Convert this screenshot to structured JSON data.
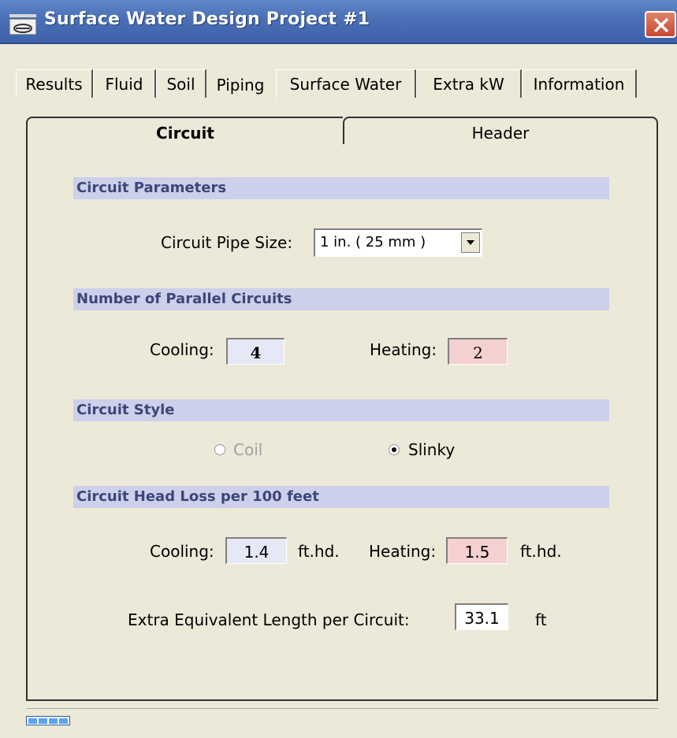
{
  "window": {
    "title": "Surface Water Design Project #1"
  },
  "tabs": [
    "Results",
    "Fluid",
    "Soil",
    "Piping",
    "Surface Water",
    "Extra kW",
    "Information"
  ],
  "active_tab": "Piping",
  "subtabs": {
    "circuit": "Circuit",
    "header": "Header"
  },
  "sections": {
    "params": "Circuit Parameters",
    "parallel": "Number of Parallel Circuits",
    "style": "Circuit Style",
    "headloss": "Circuit Head Loss per 100 feet"
  },
  "pipe_size": {
    "label": "Circuit Pipe Size:",
    "value": "1 in. ( 25 mm )"
  },
  "parallel": {
    "cooling_label": "Cooling:",
    "cooling": "4",
    "heating_label": "Heating:",
    "heating": "2"
  },
  "style": {
    "coil": "Coil",
    "slinky": "Slinky",
    "selected": "Slinky"
  },
  "headloss": {
    "cooling_label": "Cooling:",
    "cooling": "1.4",
    "cooling_unit": "ft.hd.",
    "heating_label": "Heating:",
    "heating": "1.5",
    "heating_unit": "ft.hd."
  },
  "extra_length": {
    "label": "Extra Equivalent Length per Circuit:",
    "value": "33.1",
    "unit": "ft"
  },
  "colors": {
    "cooling_bg": "#e6e8f7",
    "heating_bg": "#f4d0d0",
    "section_bg": "#ccd0eb",
    "titlebar": "#4a6fb6"
  }
}
